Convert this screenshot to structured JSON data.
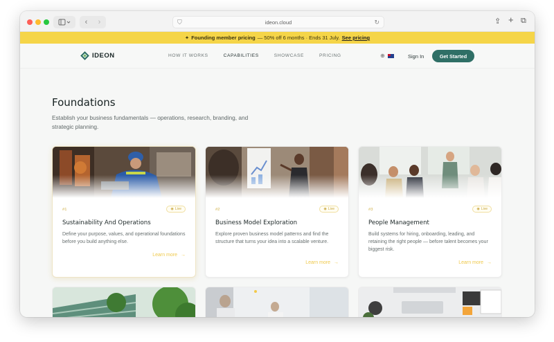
{
  "browser": {
    "url": "ideon.cloud"
  },
  "banner": {
    "icon": "sparkle-icon",
    "lead": "Founding member pricing",
    "detail": "— 50% off 6 months · Ends 31 July.",
    "link": "See pricing"
  },
  "nav": {
    "logo": "IDEON",
    "links": [
      "HOW IT WORKS",
      "CAPABILITIES",
      "SHOWCASE",
      "PRICING"
    ],
    "active": "CAPABILITIES",
    "signin": "Sign In",
    "cta": "Get Started"
  },
  "hero": {
    "title": "Foundations",
    "lead": "Establish your business fundamentals — operations, research, branding, and strategic planning."
  },
  "cards": [
    {
      "num": "#1",
      "badge": "Live",
      "title": "Sustainability And Operations",
      "desc": "Define your purpose, values, and operational foundations before you build anything else.",
      "link": "Learn more"
    },
    {
      "num": "#2",
      "badge": "Live",
      "title": "Business Model Exploration",
      "desc": "Explore proven business model patterns and find the structure that turns your idea into a scalable venture.",
      "link": "Learn more"
    },
    {
      "num": "#3",
      "badge": "Live",
      "title": "People Management",
      "desc": "Build systems for hiring, onboarding, leading, and retaining the right people — before talent becomes your biggest risk.",
      "link": "Learn more"
    }
  ],
  "colors": {
    "accent": "#2f6f66",
    "banner": "#f5d548",
    "link": "#efc94b"
  }
}
